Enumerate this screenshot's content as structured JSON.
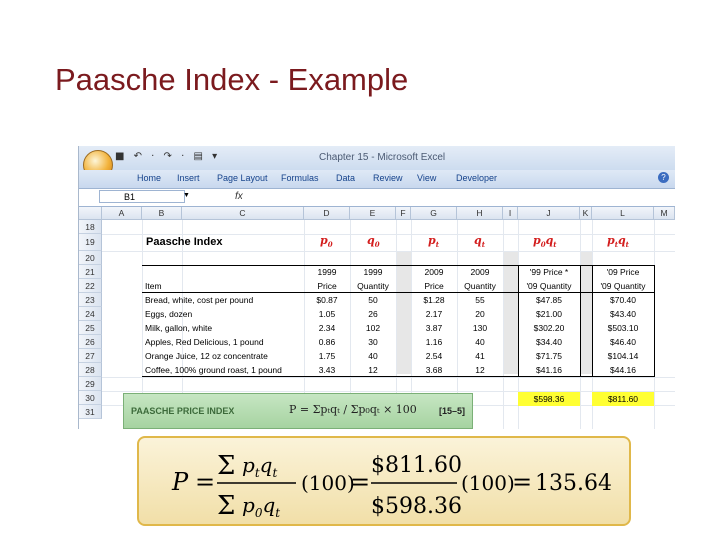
{
  "slide": {
    "title": "Paasche Index - Example"
  },
  "excel": {
    "window_title": "Chapter 15 - Microsoft Excel",
    "quick_access": "■ ↶ · ↷ · ▤ ▾",
    "tabs": [
      "Home",
      "Insert",
      "Page Layout",
      "Formulas",
      "Data",
      "Review",
      "View",
      "Developer"
    ],
    "help_glyph": "?",
    "name_box": "B1",
    "fx_label": "fx",
    "columns": [
      "A",
      "B",
      "C",
      "D",
      "E",
      "F",
      "G",
      "H",
      "I",
      "J",
      "K",
      "L",
      "M"
    ],
    "rows": [
      "18",
      "19",
      "20",
      "21",
      "22",
      "23",
      "24",
      "25",
      "26",
      "27",
      "28",
      "29",
      "30",
      "31"
    ],
    "sheet_title": "Paasche Index",
    "var_headers": [
      "p",
      "q",
      "p",
      "q",
      "p",
      "q",
      "p",
      "q"
    ],
    "var_subs": [
      "0",
      "0",
      "t",
      "t",
      "0",
      "t",
      "t",
      "t"
    ],
    "header_row1": [
      "1999",
      "1999",
      "2009",
      "2009",
      "'99 Price *",
      "'09 Price"
    ],
    "header_row2": [
      "Item",
      "Price",
      "Quantity",
      "Price",
      "Quantity",
      "'09 Quantity",
      "'09 Quantity"
    ],
    "items": [
      [
        "Bread, white, cost per pound",
        "$0.87",
        "50",
        "$1.28",
        "55",
        "$47.85",
        "$70.40"
      ],
      [
        "Eggs, dozen",
        "1.05",
        "26",
        "2.17",
        "20",
        "$21.00",
        "$43.40"
      ],
      [
        "Milk, gallon, white",
        "2.34",
        "102",
        "3.87",
        "130",
        "$302.20",
        "$503.10"
      ],
      [
        "Apples, Red Delicious, 1 pound",
        "0.86",
        "30",
        "1.16",
        "40",
        "$34.40",
        "$46.40"
      ],
      [
        "Orange Juice, 12 oz concentrate",
        "1.75",
        "40",
        "2.54",
        "41",
        "$71.75",
        "$104.14"
      ],
      [
        "Coffee, 100% ground roast, 1 pound",
        "3.43",
        "12",
        "3.68",
        "12",
        "$41.16",
        "$44.16"
      ]
    ],
    "totals": [
      "$598.36",
      "$811.60"
    ]
  },
  "textbook_box": {
    "label": "PAASCHE PRICE INDEX",
    "formula": "P = Σpₜqₜ / Σp₀qₜ × 100",
    "equation_number": "[15–5]"
  },
  "formula": {
    "lhs": "P",
    "numerator_sum": "811.60",
    "denominator_sum": "598.36",
    "multiplier": "(100)",
    "result": "135.64"
  }
}
